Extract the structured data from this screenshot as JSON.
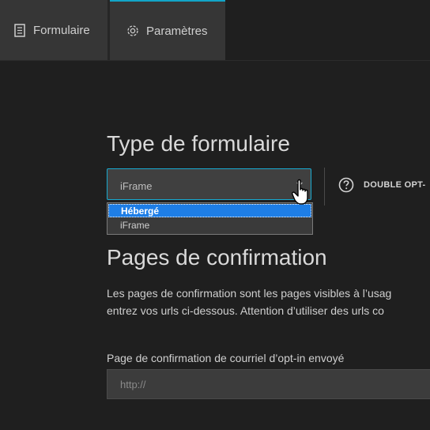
{
  "tabs": [
    {
      "label": "Formulaire",
      "icon": "form-icon"
    },
    {
      "label": "Paramètres",
      "icon": "gear-icon"
    }
  ],
  "form_type": {
    "title": "Type de formulaire",
    "select_value": "iFrame",
    "options": [
      "Hébergé",
      "iFrame"
    ],
    "highlighted_option": "Hébergé"
  },
  "double_opt": {
    "label": "DOUBLE OPT-",
    "icon": "help-circle-icon"
  },
  "confirmation": {
    "title": "Pages de confirmation",
    "paragraph_line1": "Les pages de confirmation sont les pages visibles à l’usag",
    "paragraph_line2": "entrez vos urls ci-dessous. Attention d’utiliser des urls co",
    "field_label": "Page de confirmation de courriel d’opt-in envoyé",
    "field_placeholder": "http://"
  },
  "colors": {
    "accent": "#12a5c8",
    "highlight": "#1e7ee6",
    "background": "#1f1f1f"
  }
}
